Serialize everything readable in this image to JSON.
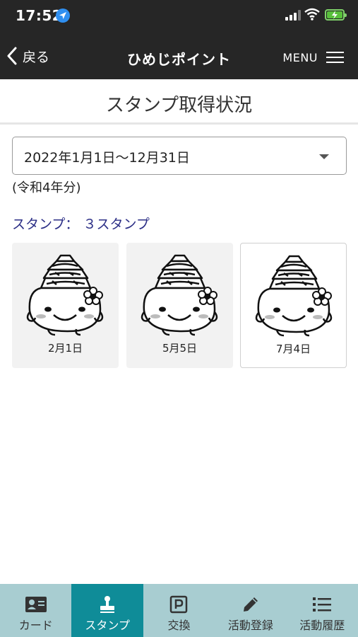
{
  "status_bar": {
    "time": "17:52"
  },
  "nav": {
    "back_label": "戻る",
    "title": "ひめじポイント",
    "menu_label": "MENU"
  },
  "page": {
    "title": "スタンプ取得状況"
  },
  "period": {
    "selected": "2022年1月1日〜12月31日",
    "note": "(令和4年分)"
  },
  "stamps": {
    "count_label": "スタンプ： ３スタンプ",
    "items": [
      {
        "date": "2月1日"
      },
      {
        "date": "5月5日"
      },
      {
        "date": "7月4日"
      }
    ]
  },
  "tabs": [
    {
      "label": "カード",
      "icon": "card-icon",
      "active": false
    },
    {
      "label": "スタンプ",
      "icon": "stamp-icon",
      "active": true
    },
    {
      "label": "交換",
      "icon": "parking-p-icon",
      "active": false
    },
    {
      "label": "活動登録",
      "icon": "pencil-icon",
      "active": false
    },
    {
      "label": "活動履歴",
      "icon": "list-icon",
      "active": false
    }
  ],
  "colors": {
    "header_bg": "#262626",
    "accent_blue": "#2b2e86",
    "tab_bg": "#a8cdd1",
    "tab_active": "#0f8c98"
  }
}
